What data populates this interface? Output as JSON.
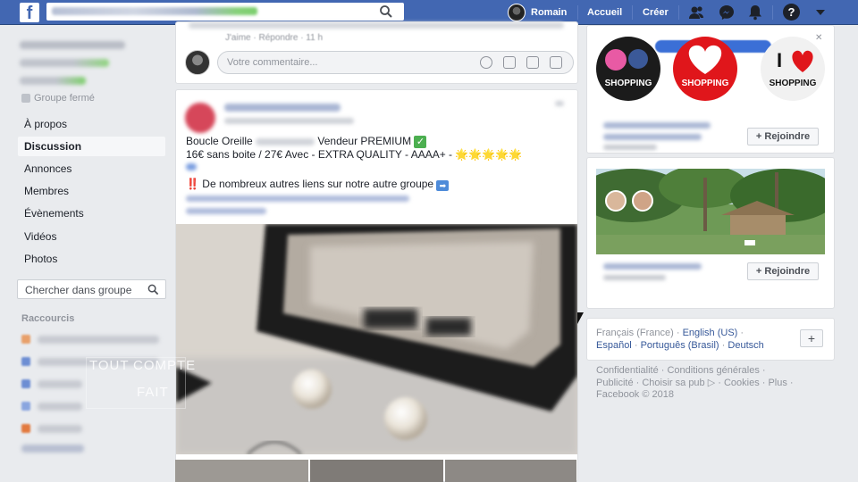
{
  "topbar": {
    "logo": "f",
    "user_name": "Romain",
    "home_label": "Accueil",
    "create_label": "Créer",
    "help_label": "?"
  },
  "sidebar": {
    "group_status": "Groupe fermé",
    "items": [
      {
        "label": "À propos",
        "active": false
      },
      {
        "label": "Discussion",
        "active": true
      },
      {
        "label": "Annonces",
        "active": false
      },
      {
        "label": "Membres",
        "active": false
      },
      {
        "label": "Évènements",
        "active": false
      },
      {
        "label": "Vidéos",
        "active": false
      },
      {
        "label": "Photos",
        "active": false
      }
    ],
    "search_placeholder": "Chercher dans groupe",
    "shortcuts_title": "Raccourcis"
  },
  "watermark": {
    "line1_a": "TOUT",
    "line1_b": "COMPTE",
    "line2": "FAIT"
  },
  "feed": {
    "prev_comment": {
      "like": "J'aime",
      "reply": "Répondre",
      "time": "11 h"
    },
    "comment_placeholder": "Votre commentaire...",
    "post": {
      "line1_a": "Boucle Oreille",
      "line1_b": "Vendeur PREMIUM",
      "line2": "16€ sans boite / 27€ Avec - EXTRA QUALITY - AAAA+ -",
      "line3": "De nombreux autres liens sur notre autre groupe"
    }
  },
  "right": {
    "shop_text": "SHOPPING",
    "join_label": "+ Rejoindre",
    "languages": {
      "current": "Français (France)",
      "links": [
        "English (US)",
        "Español",
        "Português (Brasil)",
        "Deutsch"
      ]
    },
    "footer": {
      "line1": "Confidentialité · Conditions générales ·",
      "line2": "Publicité · Choisir sa pub ▷ · Cookies · Plus ·",
      "line3": "Facebook © 2018"
    }
  },
  "colors": {
    "brand": "#4267b2",
    "link": "#365899",
    "muted": "#90949c"
  }
}
